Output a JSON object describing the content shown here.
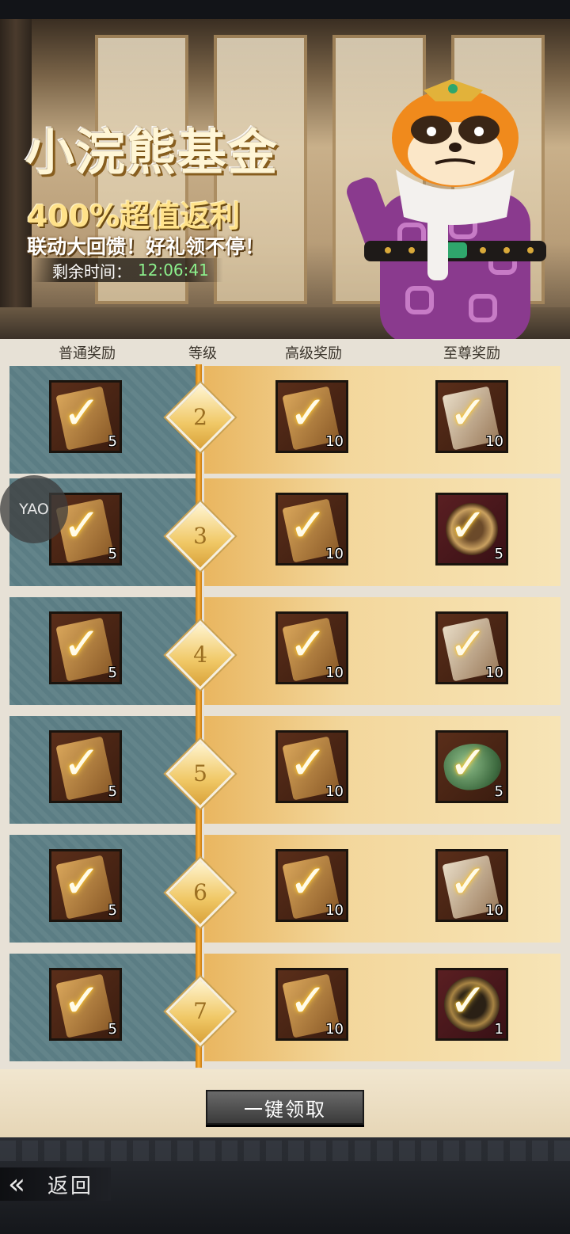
{
  "banner": {
    "title": "小浣熊基金",
    "subtitle": "400%超值返利",
    "slogan": "联动大回馈！好礼领不停！",
    "timer_label": "剩余时间：",
    "timer_value": "12:06:41"
  },
  "columns": {
    "normal": "普通奖励",
    "level": "等级",
    "advanced": "高级奖励",
    "supreme": "至尊奖励"
  },
  "rows": [
    {
      "level": "2",
      "normal_count": "5",
      "advanced_count": "10",
      "supreme_count": "10",
      "supreme_icon": "scroll-icon"
    },
    {
      "level": "3",
      "normal_count": "5",
      "advanced_count": "10",
      "supreme_count": "5",
      "supreme_icon": "coin-icon"
    },
    {
      "level": "4",
      "normal_count": "5",
      "advanced_count": "10",
      "supreme_count": "10",
      "supreme_icon": "scroll-icon"
    },
    {
      "level": "5",
      "normal_count": "5",
      "advanced_count": "10",
      "supreme_count": "5",
      "supreme_icon": "jade-icon"
    },
    {
      "level": "6",
      "normal_count": "5",
      "advanced_count": "10",
      "supreme_count": "10",
      "supreme_icon": "scroll-icon"
    },
    {
      "level": "7",
      "normal_count": "5",
      "advanced_count": "10",
      "supreme_count": "1",
      "supreme_icon": "medal-icon"
    }
  ],
  "floating_button": "YAO",
  "claim_all": "一键领取",
  "back": "返回",
  "colors": {
    "normal_bg": "#5b7d84",
    "premium_bg": "#f3d79c",
    "timer_value": "#8cf08c",
    "spine": "#ffb43a"
  }
}
